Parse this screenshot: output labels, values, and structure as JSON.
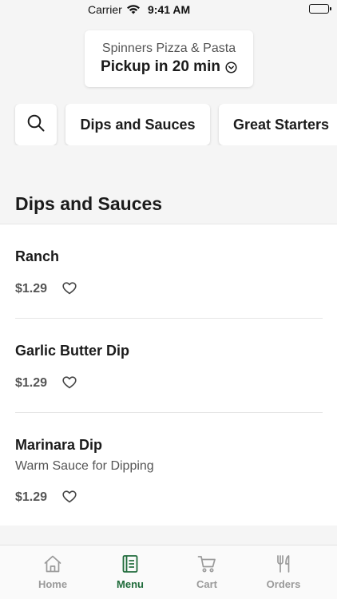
{
  "status_bar": {
    "carrier": "Carrier",
    "time": "9:41 AM"
  },
  "location": {
    "restaurant": "Spinners Pizza & Pasta",
    "pickup": "Pickup in 20 min",
    "dropdown_icon": "chevron-down-circle-icon"
  },
  "categories": {
    "search_icon": "search-icon",
    "chips": [
      "Dips and Sauces",
      "Great Starters"
    ]
  },
  "section": {
    "title": "Dips and Sauces"
  },
  "items": [
    {
      "name": "Ranch",
      "description": "",
      "price": "$1.29"
    },
    {
      "name": "Garlic Butter Dip",
      "description": "",
      "price": "$1.29"
    },
    {
      "name": "Marinara Dip",
      "description": "Warm Sauce for Dipping",
      "price": "$1.29"
    }
  ],
  "tabs": [
    {
      "label": "Home",
      "icon": "home-icon",
      "active": false
    },
    {
      "label": "Menu",
      "icon": "menu-book-icon",
      "active": true
    },
    {
      "label": "Cart",
      "icon": "cart-icon",
      "active": false
    },
    {
      "label": "Orders",
      "icon": "fork-knife-icon",
      "active": false
    }
  ],
  "colors": {
    "accent": "#1f6b3a",
    "inactive_tab": "#9a9a9a",
    "background": "#f5f5f5"
  }
}
